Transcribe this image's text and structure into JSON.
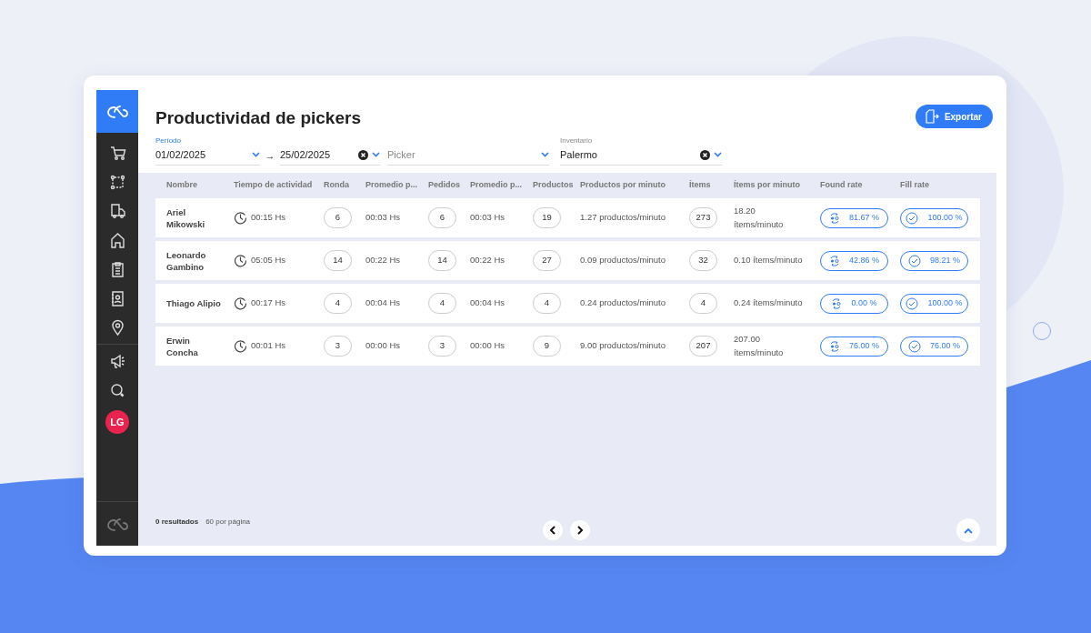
{
  "page": {
    "title": "Productividad de pickers",
    "export_button": "Exportar"
  },
  "filters": {
    "period": {
      "label": "Período",
      "from": "01/02/2025",
      "arrow": "→",
      "to": "25/02/2025"
    },
    "picker": {
      "placeholder": "Picker"
    },
    "inventory": {
      "label": "Inventario",
      "value": "Palermo"
    }
  },
  "user": {
    "initials": "LG"
  },
  "table": {
    "columns": [
      "Nombre",
      "Tiempo de actividad",
      "Ronda",
      "Promedio p...",
      "Pedidos",
      "Promedio p...",
      "Productos",
      "Productos por minuto",
      "Ítems",
      "Ítems por minuto",
      "Found rate",
      "Fill rate"
    ],
    "rows": [
      {
        "name": "Ariel Mikowski",
        "time": "00:15 Hs",
        "rounds": "6",
        "avg_round": "00:03 Hs",
        "orders": "6",
        "avg_order": "00:03 Hs",
        "products": "19",
        "products_per_minute": "1.27 productos/minuto",
        "items": "273",
        "items_per_minute": "18.20 ítems/minuto",
        "found_rate": "81.67 %",
        "fill_rate": "100.00 %"
      },
      {
        "name": "Leonardo Gambino",
        "time": "05:05 Hs",
        "rounds": "14",
        "avg_round": "00:22 Hs",
        "orders": "14",
        "avg_order": "00:22 Hs",
        "products": "27",
        "products_per_minute": "0.09 productos/minuto",
        "items": "32",
        "items_per_minute": "0.10 ítems/minuto",
        "found_rate": "42.86 %",
        "fill_rate": "98.21 %"
      },
      {
        "name": "Thiago Alipio",
        "time": "00:17 Hs",
        "rounds": "4",
        "avg_round": "00:04 Hs",
        "orders": "4",
        "avg_order": "00:04 Hs",
        "products": "4",
        "products_per_minute": "0.24 productos/minuto",
        "items": "4",
        "items_per_minute": "0.24 ítems/minuto",
        "found_rate": "0.00 %",
        "fill_rate": "100.00 %"
      },
      {
        "name": "Erwin Concha",
        "time": "00:01 Hs",
        "rounds": "3",
        "avg_round": "00:00 Hs",
        "orders": "3",
        "avg_order": "00:00 Hs",
        "products": "9",
        "products_per_minute": "9.00 productos/minuto",
        "items": "207",
        "items_per_minute": "207.00 ítems/minuto",
        "found_rate": "76.00 %",
        "fill_rate": "76.00 %"
      }
    ]
  },
  "footer": {
    "results": "0 resultados",
    "per_page": "60 por página"
  }
}
